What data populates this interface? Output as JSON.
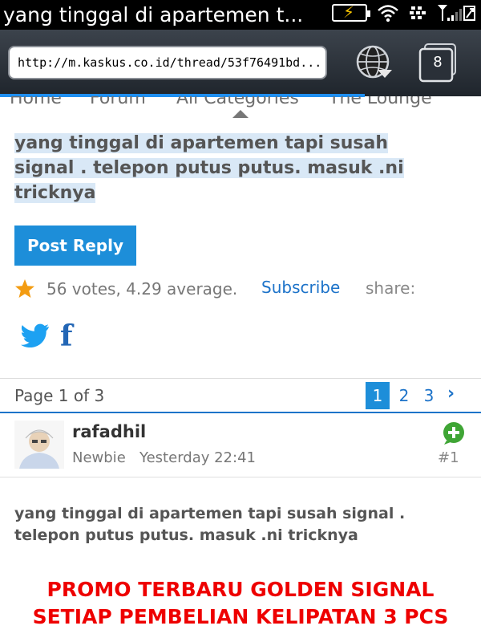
{
  "status_bar": {
    "title": "yang tinggal di apartemen t...",
    "icons": [
      "battery-charging-icon",
      "wifi-icon",
      "bbm-icon",
      "signal-icon"
    ]
  },
  "browser": {
    "url": "http://m.kaskus.co.id/thread/53f76491bd...",
    "tab_count": "8",
    "accent_color": "#1f8ff0"
  },
  "site_nav": {
    "items": [
      "Home",
      "Forum",
      "All Categories",
      "The Lounge"
    ]
  },
  "thread": {
    "title": "yang tinggal di apartemen tapi susah signal . telepon putus putus. masuk .ni tricknya",
    "post_reply_label": "Post Reply",
    "rating_text": "56 votes, 4.29 average.",
    "subscribe_label": "Subscribe",
    "share_label": "share:",
    "share_icons": [
      "twitter-icon",
      "facebook-icon"
    ],
    "facebook_glyph": "f"
  },
  "pagination": {
    "label": "Page 1 of 3",
    "pages": [
      "1",
      "2",
      "3"
    ],
    "current_page": "1",
    "next_glyph": "›"
  },
  "post": {
    "username": "rafadhil",
    "rank": "Newbie",
    "time": "Yesterday 22:41",
    "number": "#1",
    "body": "yang tinggal di apartemen tapi susah signal . telepon putus putus. masuk .ni tricknya",
    "promo_line1": "PROMO TERBARU GOLDEN SIGNAL",
    "promo_line2": "SETIAP PEMBELIAN KELIPATAN 3 PCS"
  }
}
